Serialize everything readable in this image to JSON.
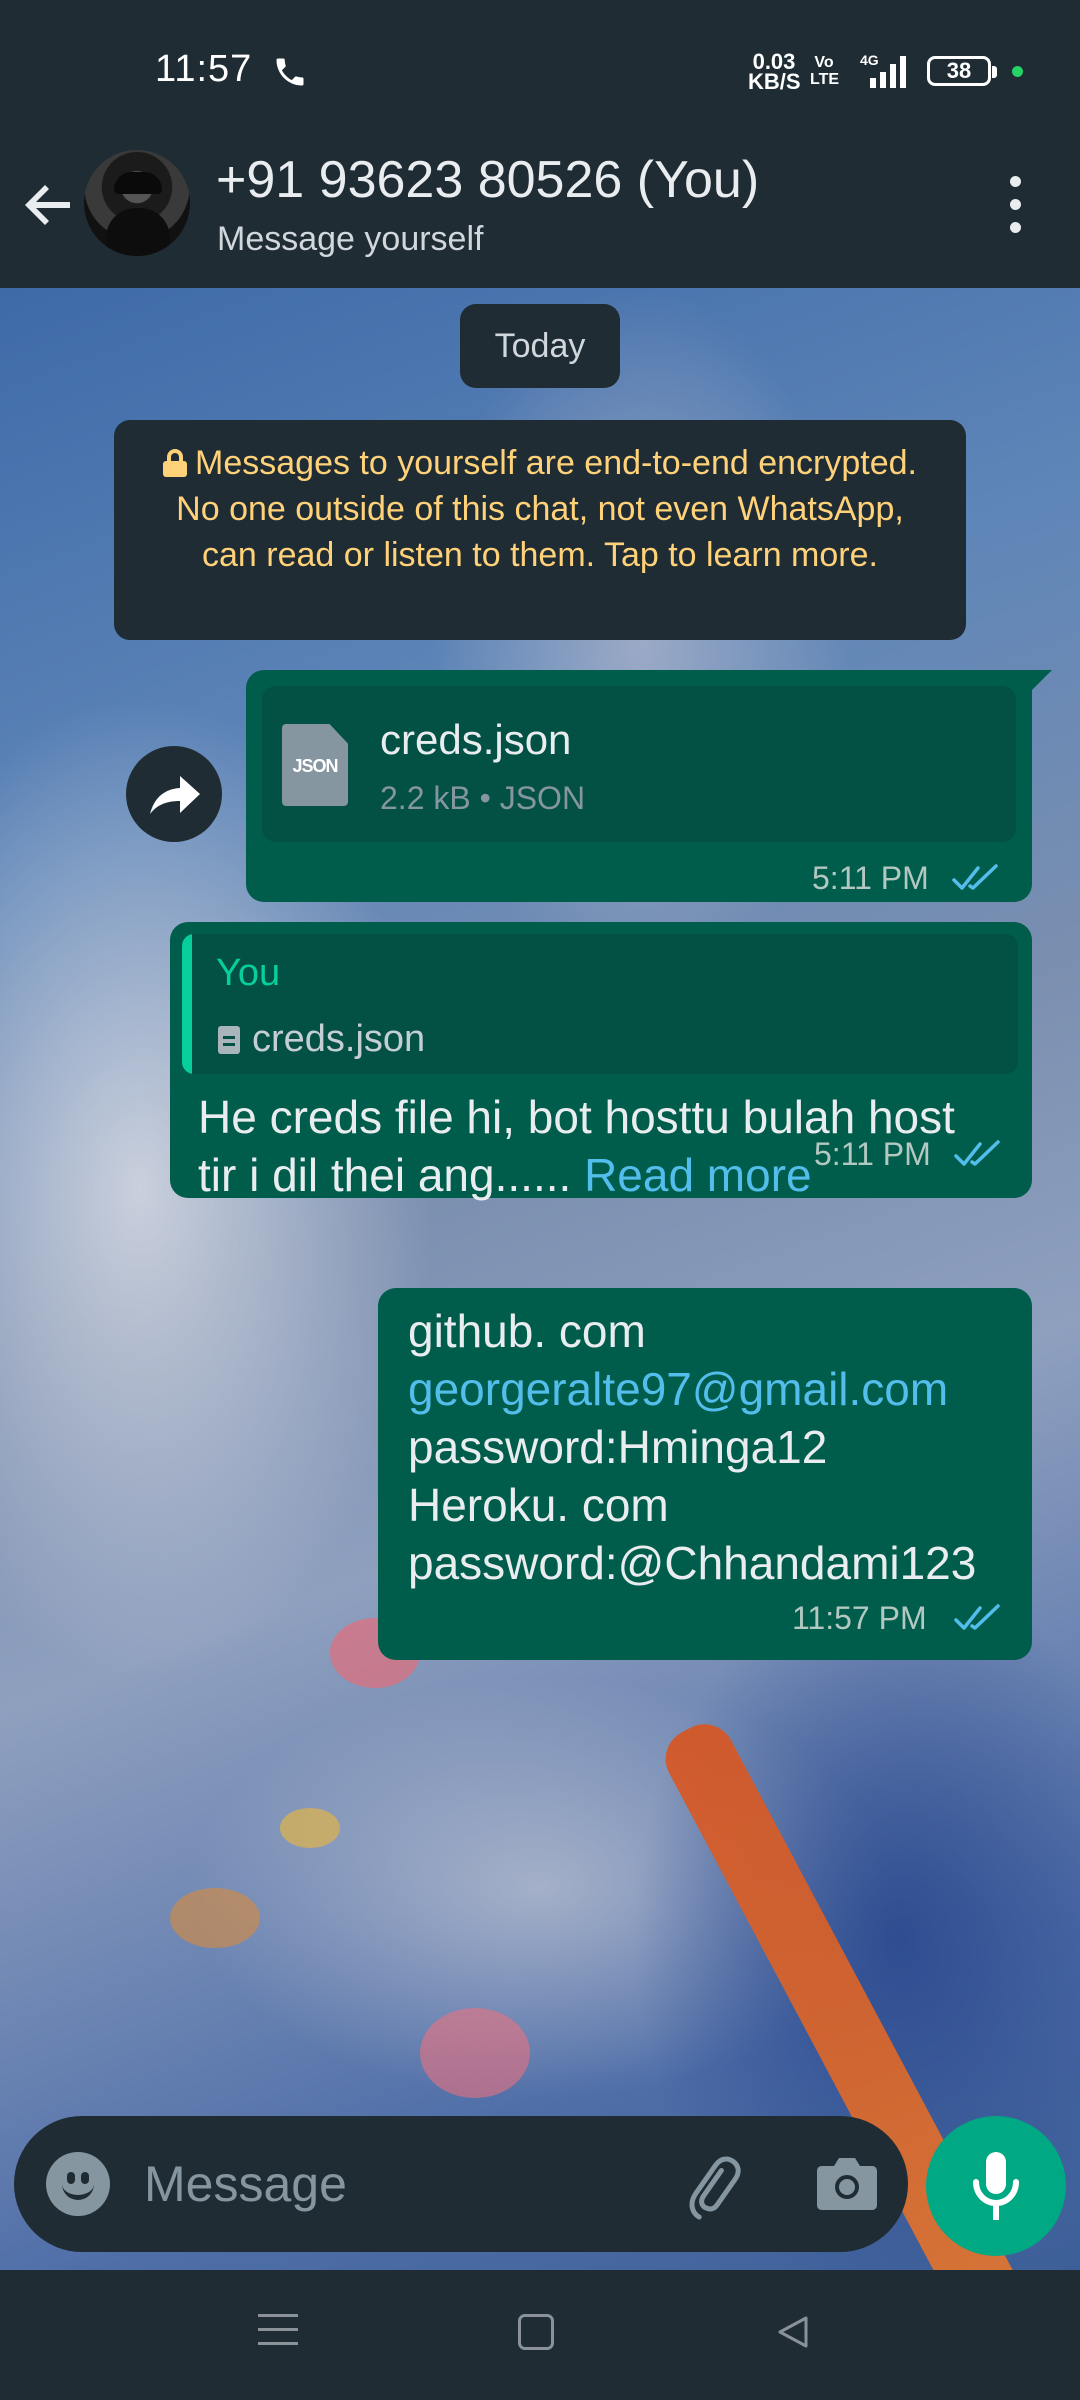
{
  "status_bar": {
    "time": "11:57",
    "net_speed": "0.03\nKB/S",
    "volte": "Vo\nLTE",
    "network": "4G",
    "battery": "38"
  },
  "header": {
    "title": "+91 93623 80526 (You)",
    "subtitle": "Message yourself"
  },
  "chat": {
    "day_label": "Today",
    "encryption_notice": "Messages to yourself are end-to-end encrypted. No one outside of this chat, not even WhatsApp, can read or listen to them. Tap to learn more.",
    "messages": [
      {
        "type": "document",
        "file_name": "creds.json",
        "file_meta": "2.2 kB • JSON",
        "icon_label": "JSON",
        "time": "5:11 PM",
        "status": "read"
      },
      {
        "type": "reply",
        "quote_author": "You",
        "quote_text": "creds.json",
        "text": "He creds file hi,  bot hosttu bulah host tir i dil thei ang......",
        "read_more": "Read more",
        "time": "5:11 PM",
        "status": "read"
      },
      {
        "type": "text",
        "lines": [
          "github. com",
          "georgeralte97@gmail.com",
          "password:Hminga12",
          "Heroku. com",
          "password:@Chhandami123"
        ],
        "time": "11:57 PM",
        "status": "read"
      }
    ]
  },
  "composer": {
    "placeholder": "Message"
  },
  "colors": {
    "header_bg": "#1f2c34",
    "outgoing_bubble": "#005c4b",
    "accent": "#00a884",
    "link": "#53bdeb",
    "notice_text": "#ffd279"
  },
  "icons": [
    "phone-icon",
    "signal-icon",
    "back-arrow-icon",
    "more-vert-icon",
    "lock-icon",
    "json-file-icon",
    "forward-icon",
    "double-check-icon",
    "emoji-icon",
    "attach-icon",
    "camera-icon",
    "mic-icon"
  ]
}
